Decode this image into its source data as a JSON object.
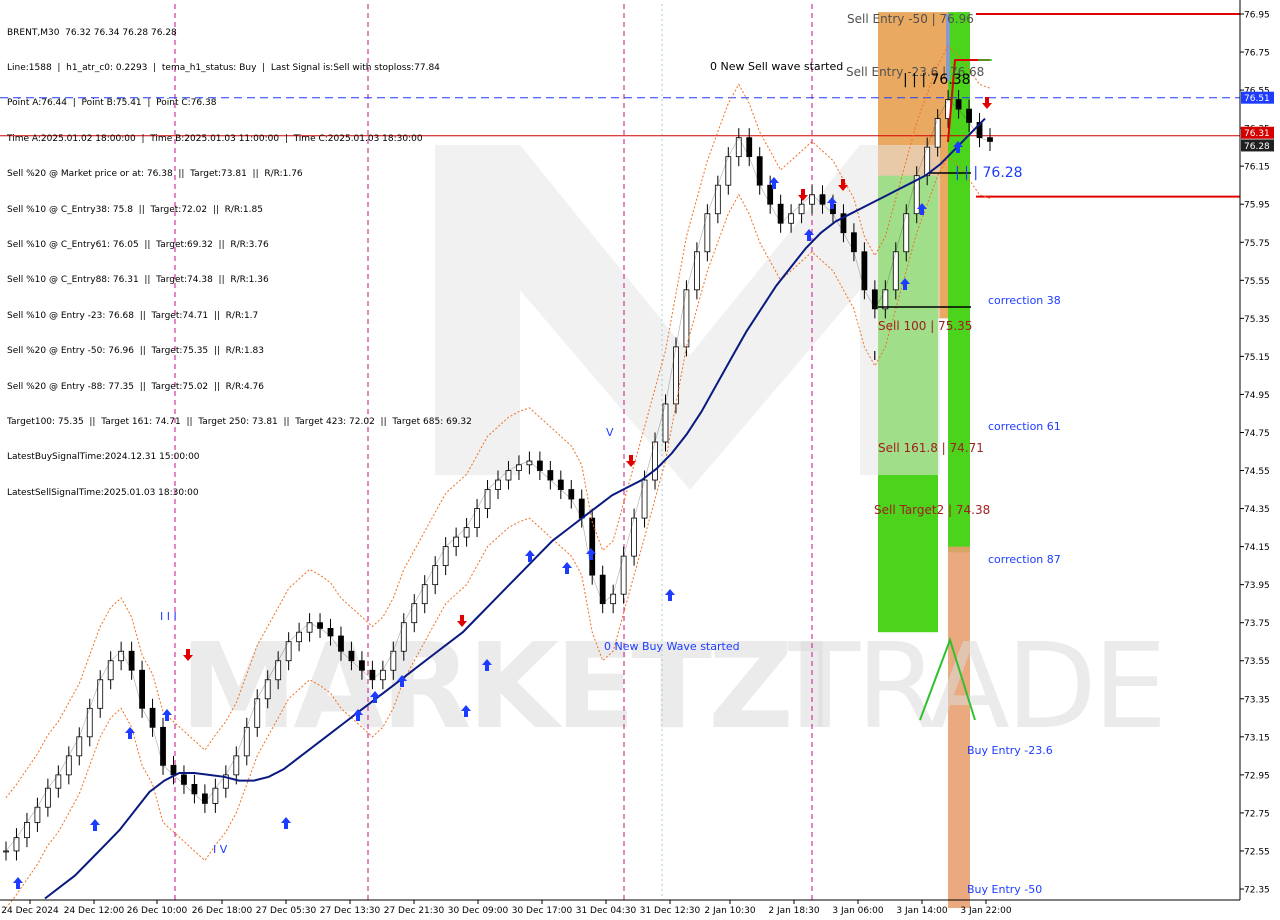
{
  "symbol_line": "BRENT,M30  76.32 76.34 76.28 76.28",
  "info_lines": [
    "Line:1588  |  h1_atr_c0: 0.2293  |  tema_h1_status: Buy  |  Last Signal is:Sell with stoploss:77.84",
    "Point A:76.44  |  Point B:75.41  |  Point C:76.38",
    "Time A:2025.01.02 18:00:00  |  Time B:2025.01.03 11:00:00  |  Time C:2025.01.03 18:30:00",
    "Sell %20 @ Market price or at: 76.38  ||  Target:73.81  ||  R/R:1.76",
    "Sell %10 @ C_Entry38: 75.8  ||  Target:72.02  ||  R/R:1.85",
    "Sell %10 @ C_Entry61: 76.05  ||  Target:69.32  ||  R/R:3.76",
    "Sell %10 @ C_Entry88: 76.31  ||  Target:74.38  ||  R/R:1.36",
    "Sell %10 @ Entry -23: 76.68  ||  Target:74.71  ||  R/R:1.7",
    "Sell %20 @ Entry -50: 76.96  ||  Target:75.35  ||  R/R:1.83",
    "Sell %20 @ Entry -88: 77.35  ||  Target:75.02  ||  R/R:4.76",
    "Target100: 75.35  ||  Target 161: 74.71  ||  Target 250: 73.81  ||  Target 423: 72.02  ||  Target 685: 69.32",
    "LatestBuySignalTime:2024.12.31 15:00:00",
    "LatestSellSignalTime:2025.01.03 18:30:00"
  ],
  "chart_data": {
    "type": "candlestick",
    "ylim": [
      72.25,
      77.0
    ],
    "y_ticks": [
      "76.95",
      "76.75",
      "76.55",
      "76.35",
      "76.15",
      "75.95",
      "75.75",
      "75.55",
      "75.35",
      "75.15",
      "74.95",
      "74.75",
      "74.55",
      "74.35",
      "74.15",
      "73.95",
      "73.75",
      "73.55",
      "73.35",
      "73.15",
      "72.95",
      "72.75",
      "72.55",
      "72.35"
    ],
    "x_ticks": [
      "24 Dec 2024",
      "24 Dec 12:00",
      "26 Dec 10:00",
      "26 Dec 18:00",
      "27 Dec 05:30",
      "27 Dec 13:30",
      "27 Dec 21:30",
      "30 Dec 09:00",
      "30 Dec 17:00",
      "31 Dec 04:30",
      "31 Dec 12:30",
      "2 Jan 10:30",
      "2 Jan 18:30",
      "3 Jan 06:00",
      "3 Jan 14:00",
      "3 Jan 22:00"
    ],
    "price_badges": [
      {
        "value": 76.51,
        "text": "76.51",
        "color": "#1e3cff"
      },
      {
        "value": 76.31,
        "text": "76.31",
        "color": "#d40000"
      },
      {
        "value": 76.28,
        "text": "76.28",
        "color": "#202020"
      }
    ],
    "h_lines": [
      {
        "value": 76.95,
        "color": "#e00000",
        "style": "solid",
        "from": "3 Jan 22:00"
      },
      {
        "value": 76.51,
        "color": "#1e3cff",
        "style": "dashed",
        "from": "start"
      },
      {
        "value": 76.31,
        "color": "#d40000",
        "style": "solid",
        "from": "start"
      },
      {
        "value": 75.99,
        "color": "#e00000",
        "style": "solid",
        "from": "3 Jan 22:00"
      }
    ],
    "session_separators": [
      "26 Dec 10:00",
      "27 Dec 13:30",
      "31 Dec 04:30",
      "2 Jan 18:30"
    ],
    "zones": [
      {
        "kind": "sell-entry-orange",
        "from": 75.35,
        "to": 76.96
      },
      {
        "kind": "sell-target-green",
        "from": 73.7,
        "to": 76.38
      },
      {
        "kind": "buy-entry-orange",
        "from": 72.25,
        "to": 74.15
      }
    ],
    "annotations": [
      {
        "text": "Sell Entry -50 | 76.96",
        "color": "#505050"
      },
      {
        "text": "Sell Entry -23.6 | 76.68",
        "color": "#505050"
      },
      {
        "text": "| | | 76.38",
        "color": "#000000"
      },
      {
        "text": "| | | 76.28",
        "color": "#1e3cff"
      },
      {
        "text": "0 New Sell wave started",
        "color": "#000000"
      },
      {
        "text": "0 New Buy Wave started",
        "color": "#1e3cff"
      },
      {
        "text": "Sell 100 | 75.35",
        "color": "#a02020"
      },
      {
        "text": "Sell 161.8 | 74.71",
        "color": "#a02020"
      },
      {
        "text": "Sell Target2 | 74.38",
        "color": "#a02020"
      },
      {
        "text": "correction 38",
        "color": "#1e3cff"
      },
      {
        "text": "correction 61",
        "color": "#1e3cff"
      },
      {
        "text": "correction 87",
        "color": "#1e3cff"
      },
      {
        "text": "Buy Entry -23.6",
        "color": "#1e3cff"
      },
      {
        "text": "Buy Entry -50",
        "color": "#1e3cff"
      },
      {
        "text": "I I I",
        "color": "#1e3cff"
      },
      {
        "text": "I V",
        "color": "#1e3cff"
      },
      {
        "text": "V",
        "color": "#1e3cff"
      },
      {
        "text": "I",
        "color": "#000000"
      }
    ],
    "series": [
      {
        "kind": "close-trend",
        "points": [
          72.55,
          72.62,
          72.7,
          72.78,
          72.88,
          72.95,
          73.05,
          73.15,
          73.3,
          73.45,
          73.55,
          73.6,
          73.5,
          73.3,
          73.2,
          73.0,
          72.95,
          72.9,
          72.85,
          72.8,
          72.88,
          72.95,
          73.05,
          73.2,
          73.35,
          73.45,
          73.55,
          73.65,
          73.7,
          73.75,
          73.72,
          73.68,
          73.6,
          73.55,
          73.5,
          73.45,
          73.5,
          73.6,
          73.75,
          73.85,
          73.95,
          74.05,
          74.15,
          74.2,
          74.25,
          74.35,
          74.45,
          74.5,
          74.55,
          74.58,
          74.6,
          74.55,
          74.5,
          74.45,
          74.4,
          74.3,
          74.0,
          73.85,
          73.9,
          74.1,
          74.3,
          74.5,
          74.7,
          74.9,
          75.2,
          75.5,
          75.7,
          75.9,
          76.05,
          76.2,
          76.3,
          76.2,
          76.05,
          75.95,
          75.85,
          75.9,
          75.95,
          76.0,
          75.95,
          75.9,
          75.8,
          75.7,
          75.5,
          75.4,
          75.5,
          75.7,
          75.9,
          76.1,
          76.25,
          76.4,
          76.5,
          76.45,
          76.38,
          76.3,
          76.28
        ]
      },
      {
        "kind": "moving-average",
        "color": "#0a1a80",
        "points": [
          72.3,
          72.36,
          72.42,
          72.5,
          72.58,
          72.66,
          72.76,
          72.86,
          72.92,
          72.96,
          72.96,
          72.95,
          72.94,
          72.92,
          72.92,
          72.94,
          72.98,
          73.04,
          73.1,
          73.16,
          73.22,
          73.28,
          73.34,
          73.4,
          73.46,
          73.52,
          73.58,
          73.64,
          73.7,
          73.78,
          73.86,
          73.94,
          74.02,
          74.1,
          74.18,
          74.24,
          74.3,
          74.36,
          74.42,
          74.46,
          74.5,
          74.56,
          74.64,
          74.74,
          74.86,
          75.0,
          75.14,
          75.28,
          75.4,
          75.52,
          75.62,
          75.72,
          75.8,
          75.86,
          75.9,
          75.94,
          75.98,
          76.02,
          76.06,
          76.1,
          76.16,
          76.24,
          76.32,
          76.4
        ]
      }
    ]
  }
}
